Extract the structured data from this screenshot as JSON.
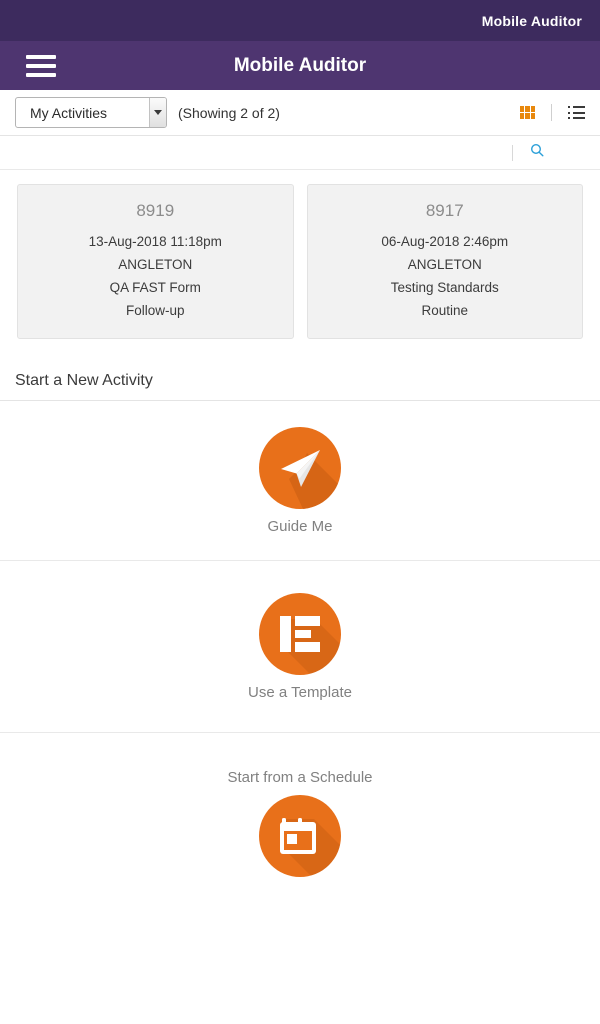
{
  "statusbar": {
    "title": "Mobile Auditor"
  },
  "header": {
    "title": "Mobile Auditor",
    "menu_icon": "hamburger-menu-icon"
  },
  "toolbar": {
    "filter_selected": "My Activities",
    "filter_options": [
      "My Activities"
    ],
    "showing_text": "(Showing 2 of 2)",
    "grid_view_icon": "grid-view-icon",
    "list_view_icon": "list-view-icon",
    "grid_view_active": true,
    "accent_orange": "#e8880d",
    "icon_gray": "#3a3a3a"
  },
  "search": {
    "icon": "search-icon",
    "icon_color": "#2a9fd8"
  },
  "activities": [
    {
      "id": "8919",
      "datetime": "13-Aug-2018 11:18pm",
      "site": "ANGLETON",
      "form": "QA FAST Form",
      "type": "Follow-up"
    },
    {
      "id": "8917",
      "datetime": "06-Aug-2018 2:46pm",
      "site": "ANGLETON",
      "form": "Testing Standards",
      "type": "Routine"
    }
  ],
  "new_activity": {
    "section_title": "Start a New Activity",
    "items": [
      {
        "label": "Guide Me",
        "icon": "paper-plane-icon",
        "label_position": "below"
      },
      {
        "label": "Use a Template",
        "icon": "template-layout-icon",
        "label_position": "below"
      },
      {
        "label": "Start from a Schedule",
        "icon": "calendar-icon",
        "label_position": "above"
      }
    ],
    "circle_color": "#e8701a"
  },
  "theme": {
    "statusbar_purple": "#3d2b5e",
    "header_purple": "#4e3570",
    "card_bg": "#f2f2f2"
  }
}
